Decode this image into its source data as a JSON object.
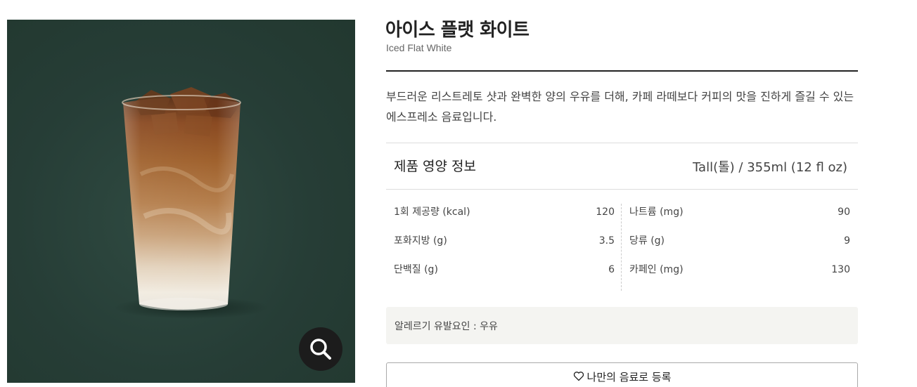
{
  "product": {
    "name_ko": "아이스 플랫 화이트",
    "name_en": "Iced Flat White",
    "description": "부드러운 리스트레토 샷과 완벽한 양의 우유를 더해, 카페 라떼보다 커피의 맛을 진하게 즐길 수 있는 에스프레소 음료입니다.",
    "image_bg_color": "#263d36"
  },
  "nutrition": {
    "title": "제품 영양 정보",
    "size": "Tall(톨) / 355ml (12 fl oz)",
    "left": [
      {
        "label": "1회 제공량 (kcal)",
        "value": "120"
      },
      {
        "label": "포화지방 (g)",
        "value": "3.5"
      },
      {
        "label": "단백질 (g)",
        "value": "6"
      }
    ],
    "right": [
      {
        "label": "나트륨 (mg)",
        "value": "90"
      },
      {
        "label": "당류 (g)",
        "value": "9"
      },
      {
        "label": "카페인 (mg)",
        "value": "130"
      }
    ]
  },
  "allergy": "알레르기 유발요인 : 우유",
  "actions": {
    "favorite_label": "나만의 음료로 등록",
    "favorite_icon": "heart-outline-icon",
    "zoom_icon": "search-icon"
  }
}
